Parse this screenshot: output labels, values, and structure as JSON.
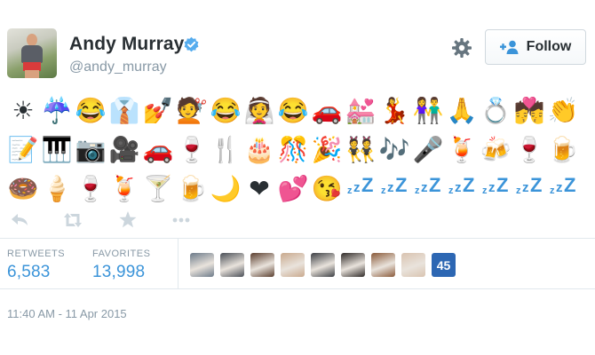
{
  "author": {
    "name": "Andy Murray",
    "handle": "@andy_murray",
    "verified_icon": "verified-badge-icon",
    "avatar": "profile-photo"
  },
  "header": {
    "settings_icon": "gear-icon",
    "follow_label": "Follow",
    "follow_icon": "add-user-icon"
  },
  "tweet": {
    "emoji_rows": [
      [
        "☀",
        "☔",
        "😂",
        "👔",
        "💅",
        "💇",
        "😂",
        "👰",
        "😂",
        "🚗",
        "💒",
        "💃",
        "👫",
        "🙏",
        "💍",
        "💏",
        "👏"
      ],
      [
        "📝",
        "🎹",
        "📷",
        "🎥",
        "🚗",
        "🍷",
        "🍴",
        "🎂",
        "🎊",
        "🎉",
        "👯",
        "🎶",
        "🎤",
        "🍹",
        "🍻",
        "🍷",
        "🍺"
      ],
      [
        "🍩",
        "🍦",
        "🍷",
        "🍹",
        "🍸",
        "🍺",
        "🌙",
        "❤",
        "💕",
        "😘",
        "zzZ",
        "zzZ",
        "zzZ",
        "zzZ",
        "zzZ",
        "zzZ",
        "zzZ"
      ]
    ]
  },
  "actions": [
    {
      "icon": "reply-icon"
    },
    {
      "icon": "retweet-icon"
    },
    {
      "icon": "favorite-star-icon"
    },
    {
      "icon": "more-dots-icon"
    }
  ],
  "stats": {
    "retweets_label": "RETWEETS",
    "retweets_value": "6,583",
    "favorites_label": "FAVORITES",
    "favorites_value": "13,998"
  },
  "favoriters": {
    "more_badge": "45",
    "face_colors": [
      "#6c7a89",
      "#4a4f57",
      "#5b3f2f",
      "#c9a98d",
      "#3c3f44",
      "#2f2a28",
      "#8a5a3a",
      "#d9c3b0"
    ]
  },
  "timestamp": "11:40 AM - 11 Apr 2015",
  "colors": {
    "link_blue": "#3b94d9",
    "muted": "#8899a6",
    "text": "#292f33",
    "verified": "#55acee"
  }
}
